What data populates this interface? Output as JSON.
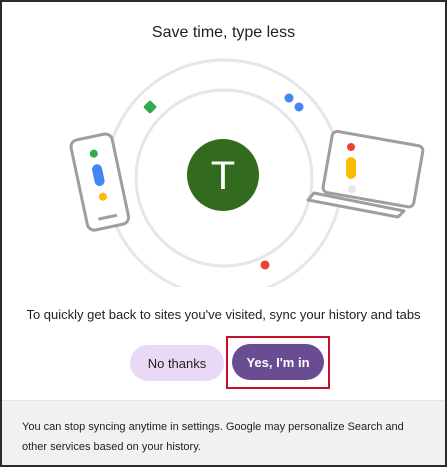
{
  "dialog": {
    "title": "Save time, type less",
    "avatar_letter": "T",
    "description": "To quickly get back to sites you've visited, sync your history and tabs",
    "no_button": "No thanks",
    "yes_button": "Yes, I'm in",
    "footer_text": "You can stop syncing anytime in settings. Google may personalize Search and other services based on your history."
  },
  "colors": {
    "avatar_bg": "#336b1e",
    "accent_purple": "#6a4c93",
    "light_purple": "#ead9f6",
    "highlight_red": "#c8102e",
    "google_blue": "#4285f4",
    "google_red": "#ea4335",
    "google_yellow": "#fbbc05",
    "google_green": "#34a853"
  }
}
